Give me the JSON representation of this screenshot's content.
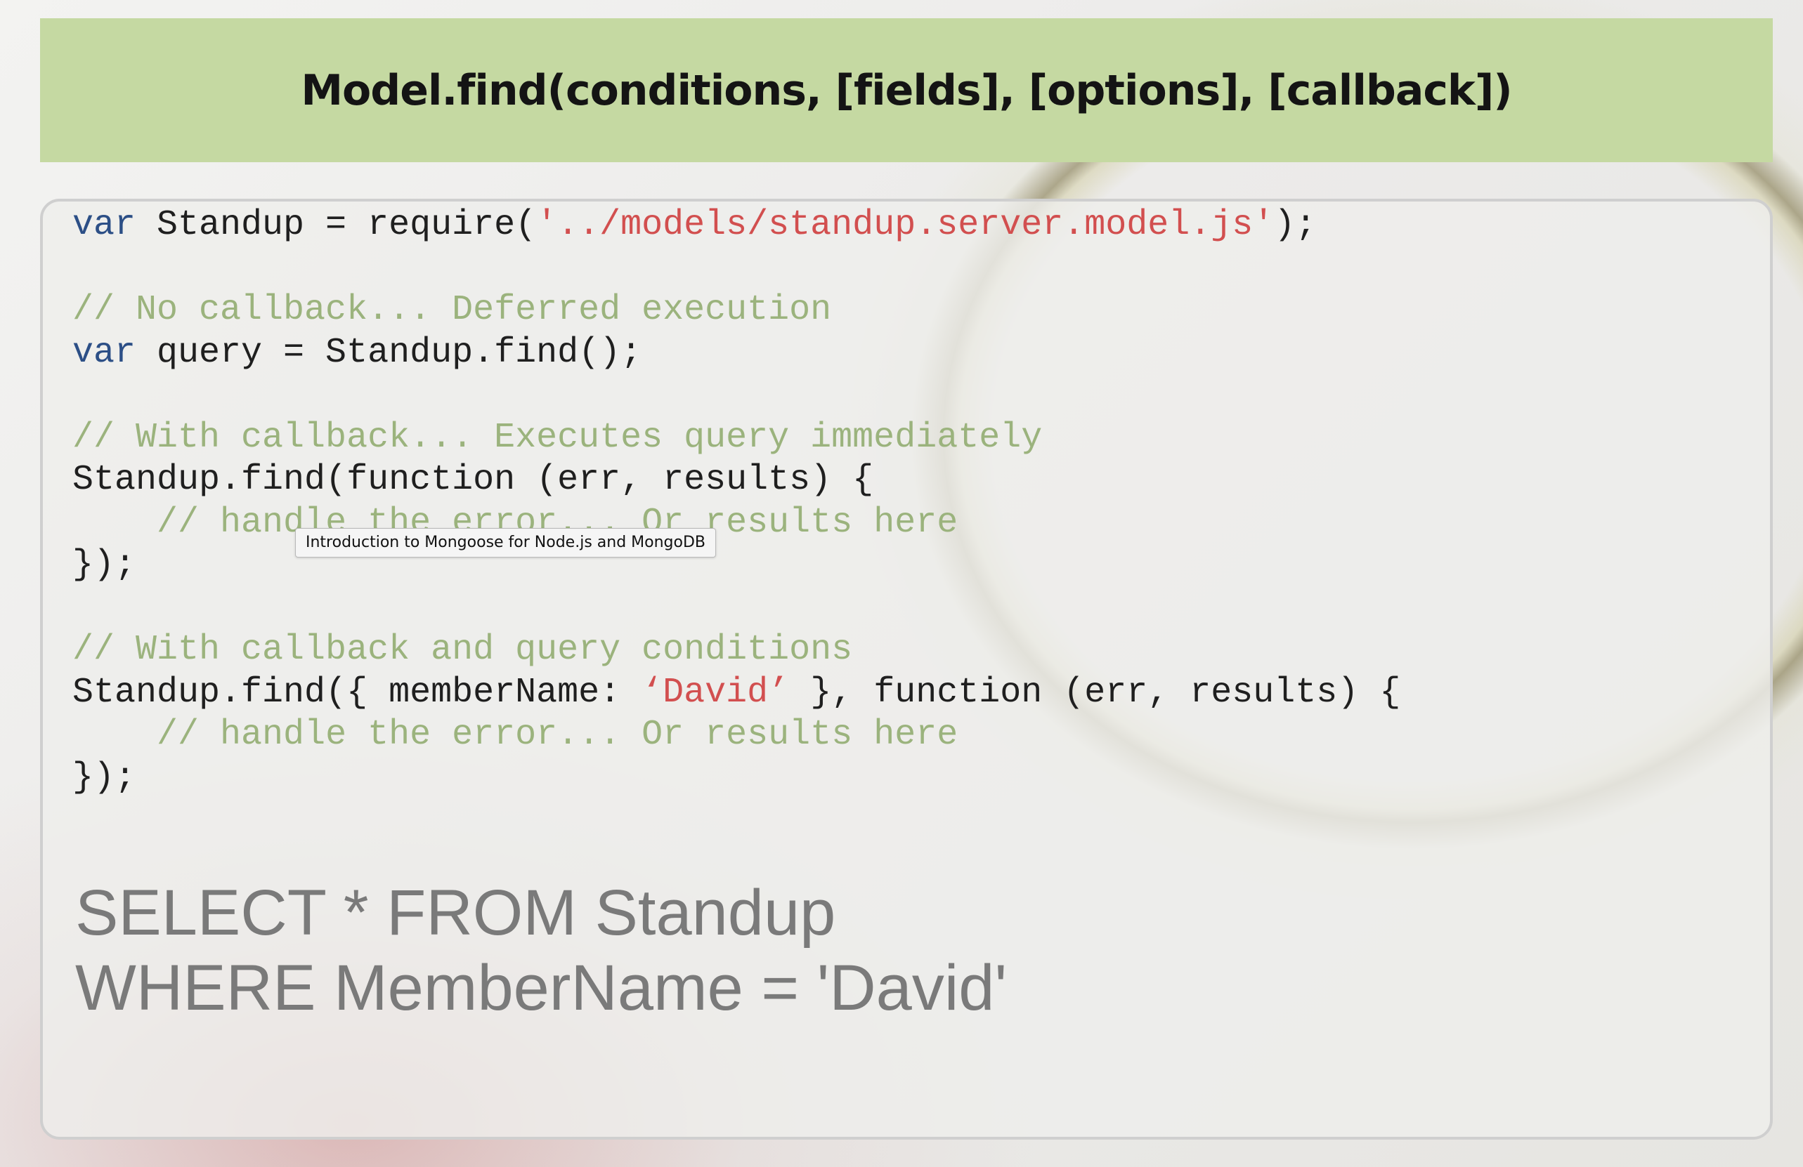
{
  "slide": {
    "title": "Model.find(conditions, [fields], [options], [callback])"
  },
  "code": {
    "line1": {
      "kw": "var",
      "text_a": " Standup = require(",
      "str": "'../models/standup.server.model.js'",
      "text_b": ");"
    },
    "line3": {
      "comment": "// No callback... Deferred execution"
    },
    "line4": {
      "kw": "var",
      "text": " query = Standup.find();"
    },
    "line6": {
      "comment": "// With callback... Executes query immediately"
    },
    "line7": {
      "text": "Standup.find(function (err, results) {"
    },
    "line8": {
      "indent": "    ",
      "comment": "// handle the error... Or results here"
    },
    "line9": {
      "text": "});"
    },
    "line11": {
      "comment": "// With callback and query conditions"
    },
    "line12": {
      "text_a": "Standup.find({ memberName: ",
      "str": "‘David’",
      "text_b": " }, function (err, results) {"
    },
    "line13": {
      "indent": "    ",
      "comment": "// handle the error... Or results here"
    },
    "line14": {
      "text": "});"
    }
  },
  "sql": {
    "line1": "SELECT * FROM Standup",
    "line2": "WHERE MemberName = 'David'"
  },
  "tooltip": {
    "text": "Introduction to Mongoose for Node.js and MongoDB"
  },
  "colors": {
    "title_bar": "#c5d9a2",
    "keyword": "#2c4f86",
    "string": "#d24f4f",
    "comment": "#9bb37d",
    "sql_text": "#7a7a7a"
  }
}
